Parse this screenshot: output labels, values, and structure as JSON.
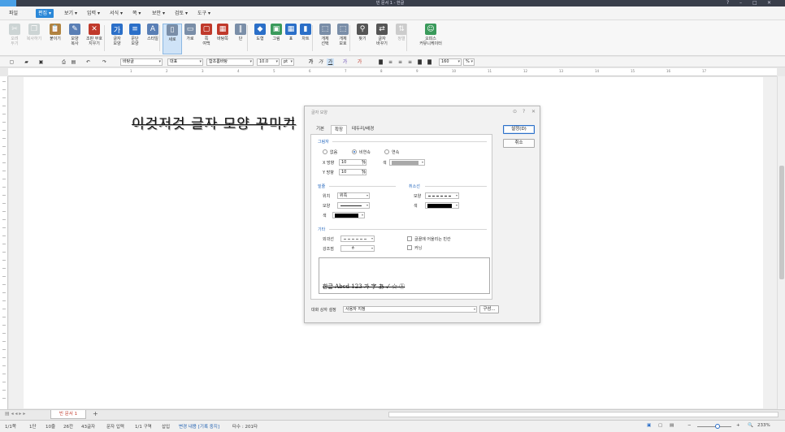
{
  "window": {
    "title": "빈 문서 1 - 한글",
    "controls": [
      "?",
      "–",
      "□",
      "✕"
    ]
  },
  "menu": [
    {
      "label": "파일"
    },
    {
      "label": "편집 ▾",
      "active": true
    },
    {
      "label": "보기 ▾"
    },
    {
      "label": "입력 ▾"
    },
    {
      "label": "서식 ▾"
    },
    {
      "label": "쪽 ▾"
    },
    {
      "label": "보안 ▾"
    },
    {
      "label": "검토 ▾"
    },
    {
      "label": "도구 ▾"
    }
  ],
  "ribbon": [
    {
      "label": "오려\n두기",
      "icon": "scissors-icon",
      "glyph": "✂",
      "color": "#9aa",
      "disabled": true
    },
    {
      "label": "복사하기",
      "icon": "copy-icon",
      "glyph": "❐",
      "color": "#9aa",
      "disabled": true
    },
    {
      "label": "붙이기",
      "icon": "paste-icon",
      "glyph": "📋",
      "color": "#b08440"
    },
    {
      "label": "모양\n복사",
      "icon": "format-copy-icon",
      "glyph": "✎",
      "color": "#5a7fb5"
    },
    {
      "label": "조판 부호\n지우기",
      "icon": "erase-icon",
      "glyph": "✕",
      "color": "#c0392b"
    },
    {
      "label": "글자\n모양",
      "icon": "char-shape-icon",
      "glyph": "가",
      "color": "#2b6fc8"
    },
    {
      "label": "문단\n모양",
      "icon": "para-shape-icon",
      "glyph": "≡",
      "color": "#2b6fc8"
    },
    {
      "label": "스타일",
      "icon": "style-icon",
      "glyph": "A",
      "color": "#5a7fb5"
    },
    {
      "label": "세로",
      "icon": "portrait-icon",
      "glyph": "▯",
      "color": "#7a8ea8",
      "selected": true
    },
    {
      "label": "가로",
      "icon": "landscape-icon",
      "glyph": "▭",
      "color": "#7a8ea8"
    },
    {
      "label": "쪽\n여백",
      "icon": "margin-icon",
      "glyph": "▢",
      "color": "#c0392b"
    },
    {
      "label": "바탕쪽",
      "icon": "master-page-icon",
      "glyph": "▦",
      "color": "#c0392b"
    },
    {
      "label": "단",
      "icon": "column-icon",
      "glyph": "‖",
      "color": "#7a8ea8"
    },
    {
      "label": "도형",
      "icon": "shape-icon",
      "glyph": "◆",
      "color": "#2b6fc8"
    },
    {
      "label": "그림",
      "icon": "picture-icon",
      "glyph": "▣",
      "color": "#3a9a5b"
    },
    {
      "label": "표",
      "icon": "table-icon",
      "glyph": "▦",
      "color": "#2b6fc8"
    },
    {
      "label": "차트",
      "icon": "chart-icon",
      "glyph": "▮",
      "color": "#2b6fc8"
    },
    {
      "label": "개체\n선택",
      "icon": "select-object-icon",
      "glyph": "⬚",
      "color": "#7a8ea8"
    },
    {
      "label": "개체\n보호",
      "icon": "protect-object-icon",
      "glyph": "⬚",
      "color": "#7a8ea8"
    },
    {
      "label": "찾기",
      "icon": "binoculars-icon",
      "glyph": "⚲",
      "color": "#555"
    },
    {
      "label": "글자\n바꾸기",
      "icon": "replace-icon",
      "glyph": "⇄",
      "color": "#555"
    },
    {
      "label": "정렬",
      "icon": "sort-icon",
      "glyph": "⇅",
      "color": "#999",
      "disabled": true
    },
    {
      "label": "오피스\n커뮤니케이터",
      "icon": "communicator-icon",
      "glyph": "☺",
      "color": "#3a9a5b"
    }
  ],
  "format_toolbar": {
    "style": "바탕글",
    "lang": "대표",
    "font": "함초롬바탕",
    "size": "10.0",
    "unit": "pt",
    "line_spacing": "160",
    "line_unit": "%",
    "bold": "가",
    "italic": "가",
    "underline": "가"
  },
  "ruler_numbers": [
    "1",
    "2",
    "3",
    "4",
    "5",
    "6",
    "7",
    "8",
    "9",
    "10",
    "11",
    "12",
    "13",
    "14",
    "15",
    "16",
    "17"
  ],
  "document": {
    "title_text": "이것저것 글자 모양 꾸미기"
  },
  "dialog": {
    "title": "글자 모양",
    "controls": [
      "⊙",
      "?",
      "✕"
    ],
    "tabs": [
      "기본",
      "확장",
      "테두리/배경"
    ],
    "active_tab": 1,
    "shadow": {
      "section": "그림자",
      "options": [
        "없음",
        "비연속",
        "연속"
      ],
      "selected": 1,
      "x_label": "X 방향",
      "x_value": "10",
      "y_label": "Y 방향",
      "y_value": "10",
      "unit": "%",
      "color_label": "색",
      "color": "#a9a9a9"
    },
    "underline": {
      "section": "밑줄",
      "position_label": "위치",
      "position_value": "위쪽",
      "shape_label": "모양",
      "color_label": "색",
      "color": "#000000"
    },
    "strike": {
      "section": "취소선",
      "shape_label": "모양",
      "color_label": "색",
      "color": "#000000"
    },
    "other": {
      "section": "기타",
      "outline_label": "외곽선",
      "emphasis_label": "강조점",
      "emphasis_value": "ㅎ",
      "fit_space": "글꼴에 어울리는 빈칸",
      "kerning": "커닝"
    },
    "preview_text": "한글 Abcd 123 가 字 あ ✓ ☆ ①",
    "dialog_setting_label": "대화 상자 설정",
    "dialog_setting_value": "사용자 지정",
    "compose_button": "구성...",
    "ok_button": "설정(D)",
    "cancel_button": "취소"
  },
  "doc_tab": {
    "label": "빈 문서 1",
    "add": "+"
  },
  "status": {
    "page": "1/1쪽",
    "section": "1단",
    "line": "10줄",
    "column": "26칸",
    "chars": "43글자",
    "mode": "문자 입력",
    "zone": "1/1 구역",
    "insert": "삽입",
    "track": "변경 내용 [기록 중지]",
    "typos": "타수 : 201타",
    "zoom": "233%"
  }
}
